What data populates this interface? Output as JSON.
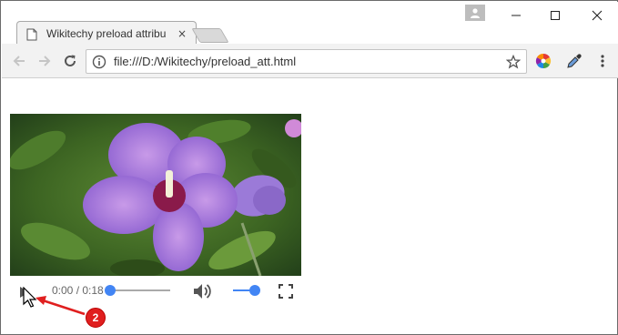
{
  "browser": {
    "tab": {
      "title": "Wikitechy preload attribu",
      "close_symbol": "×"
    },
    "address_bar": {
      "url": "file:///D:/Wikitechy/preload_att.html"
    }
  },
  "video_player": {
    "current_time": "0:00",
    "separator": " / ",
    "duration": "0:18",
    "progress_fraction": 0.0,
    "volume_fraction": 1.0
  },
  "annotation": {
    "step_number": "2",
    "badge_color": "#e01f1f"
  },
  "colors": {
    "accent": "#4285f4",
    "chrome_toolbar": "#f2f2f2"
  }
}
